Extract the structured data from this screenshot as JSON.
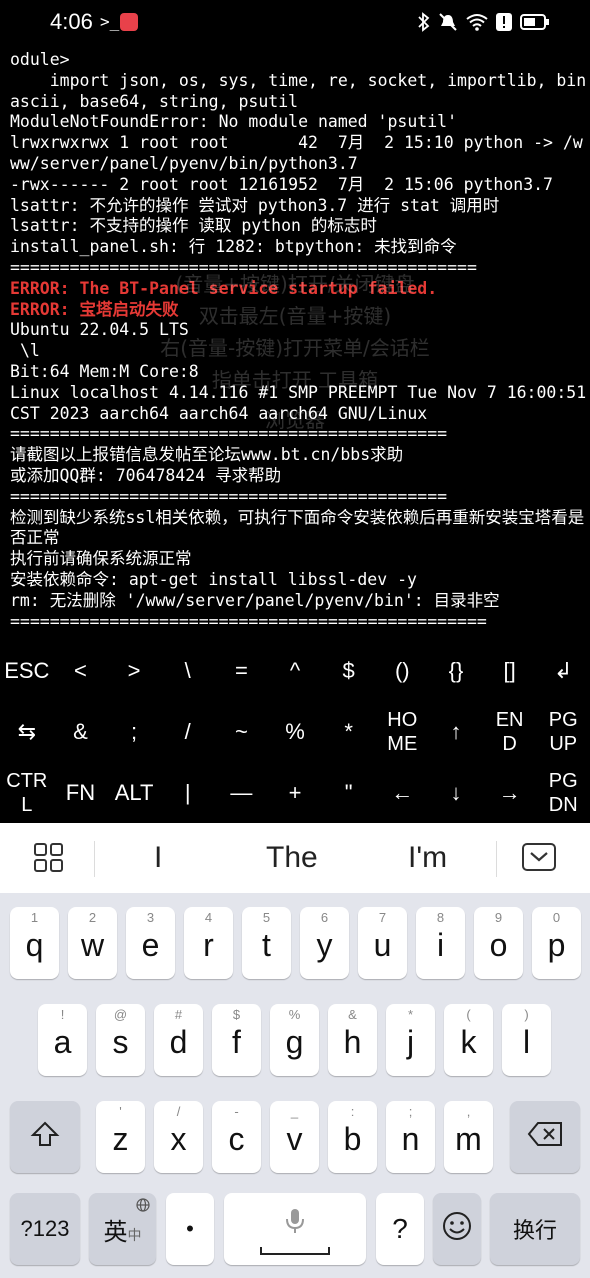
{
  "status": {
    "time": "4:06",
    "prompt": ">_"
  },
  "terminal_lines": [
    {
      "t": "odule>",
      "c": ""
    },
    {
      "t": "    import json, os, sys, time, re, socket, importlib, binascii, base64, string, psutil",
      "c": ""
    },
    {
      "t": "ModuleNotFoundError: No module named 'psutil'",
      "c": ""
    },
    {
      "t": "lrwxrwxrwx 1 root root       42  7月  2 15:10 python -> /www/server/panel/pyenv/bin/python3.7",
      "c": ""
    },
    {
      "t": "-rwx------ 2 root root 12161952  7月  2 15:06 python3.7",
      "c": ""
    },
    {
      "t": "lsattr: 不允许的操作 尝试对 python3.7 进行 stat 调用时",
      "c": ""
    },
    {
      "t": "lsattr: 不支持的操作 读取 python 的标志时",
      "c": ""
    },
    {
      "t": "install_panel.sh: 行 1282: btpython: 未找到命令",
      "c": ""
    },
    {
      "t": "===============================================",
      "c": ""
    },
    {
      "t": "ERROR: The BT-Panel service startup failed.",
      "c": "err"
    },
    {
      "t": "ERROR: 宝塔启动失败",
      "c": "err"
    },
    {
      "t": "Ubuntu 22.04.5 LTS",
      "c": ""
    },
    {
      "t": " \\l",
      "c": ""
    },
    {
      "t": "Bit:64 Mem:M Core:8",
      "c": ""
    },
    {
      "t": "Linux localhost 4.14.116 #1 SMP PREEMPT Tue Nov 7 16:00:51 CST 2023 aarch64 aarch64 aarch64 GNU/Linux",
      "c": ""
    },
    {
      "t": "============================================",
      "c": ""
    },
    {
      "t": "请截图以上报错信息发帖至论坛www.bt.cn/bbs求助",
      "c": ""
    },
    {
      "t": "或添加QQ群: 706478424 寻求帮助",
      "c": ""
    },
    {
      "t": "============================================",
      "c": ""
    },
    {
      "t": "检测到缺少系统ssl相关依赖，可执行下面命令安装依赖后再重新安装宝塔看是否正常",
      "c": ""
    },
    {
      "t": "执行前请确保系统源正常",
      "c": ""
    },
    {
      "t": "安装依赖命令: apt-get install libssl-dev -y",
      "c": ""
    },
    {
      "t": "rm: 无法删除 '/www/server/panel/pyenv/bin': 目录非空",
      "c": ""
    },
    {
      "t": "================================================",
      "c": ""
    }
  ],
  "overlay": {
    "line1": "(音量+按键)打开/关闭键盘",
    "line2": "双击最左(音量+按键)",
    "line3": "右(音量-按键)打开菜单/会话栏",
    "line4": "指单击打开 工具箱",
    "line5": "浏览器"
  },
  "extra_keys": {
    "row1": [
      "ESC",
      "<",
      ">",
      "\\",
      "=",
      "^",
      "$",
      "()",
      "{}",
      "[]",
      "↲"
    ],
    "row2": [
      "⇆",
      "&",
      ";",
      "/",
      "~",
      "%",
      "*",
      "HO\nME",
      "↑",
      "EN\nD",
      "PG\nUP"
    ],
    "row3": [
      "CTR\nL",
      "FN",
      "ALT",
      "|",
      "—",
      "+",
      "\"",
      "←",
      "↓",
      "→",
      "PG\nDN"
    ]
  },
  "suggestions": [
    "I",
    "The",
    "I'm"
  ],
  "keyboard": {
    "row1": [
      {
        "h": "1",
        "m": "q"
      },
      {
        "h": "2",
        "m": "w"
      },
      {
        "h": "3",
        "m": "e"
      },
      {
        "h": "4",
        "m": "r"
      },
      {
        "h": "5",
        "m": "t"
      },
      {
        "h": "6",
        "m": "y"
      },
      {
        "h": "7",
        "m": "u"
      },
      {
        "h": "8",
        "m": "i"
      },
      {
        "h": "9",
        "m": "o"
      },
      {
        "h": "0",
        "m": "p"
      }
    ],
    "row2": [
      {
        "h": "!",
        "m": "a"
      },
      {
        "h": "@",
        "m": "s"
      },
      {
        "h": "#",
        "m": "d"
      },
      {
        "h": "$",
        "m": "f"
      },
      {
        "h": "%",
        "m": "g"
      },
      {
        "h": "&",
        "m": "h"
      },
      {
        "h": "*",
        "m": "j"
      },
      {
        "h": "(",
        "m": "k"
      },
      {
        "h": ")",
        "m": "l"
      }
    ],
    "row3": [
      {
        "h": "'",
        "m": "z"
      },
      {
        "h": "/",
        "m": "x"
      },
      {
        "h": "-",
        "m": "c"
      },
      {
        "h": "_",
        "m": "v"
      },
      {
        "h": ":",
        "m": "b"
      },
      {
        "h": ";",
        "m": "n"
      },
      {
        "h": ",",
        "m": "m"
      }
    ],
    "num_label": "?123",
    "lang_label": "英",
    "lang_sub": "中",
    "dot_label": "•",
    "question_label": "?",
    "enter_label": "换行"
  }
}
